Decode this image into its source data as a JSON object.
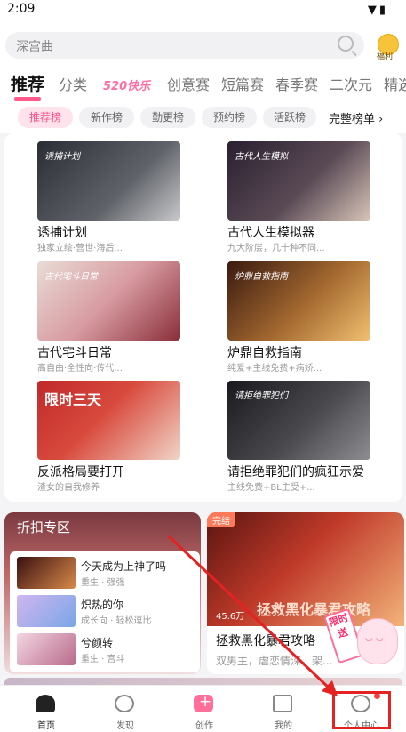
{
  "status_bar": {
    "time": "2:09"
  },
  "search": {
    "placeholder": "深宫曲"
  },
  "welfare": {
    "label": "福利"
  },
  "tabs": [
    {
      "label": "推荐"
    },
    {
      "label": "分类"
    },
    {
      "label": "520快乐"
    },
    {
      "label": "创意赛"
    },
    {
      "label": "短篇赛"
    },
    {
      "label": "春季赛"
    },
    {
      "label": "二次元"
    },
    {
      "label": "精选"
    }
  ],
  "chips": [
    {
      "label": "推荐榜"
    },
    {
      "label": "新作榜"
    },
    {
      "label": "勤更榜"
    },
    {
      "label": "预约榜"
    },
    {
      "label": "活跃榜"
    }
  ],
  "chips_more": "完整榜单 ›",
  "books": [
    {
      "title": "诱捕计划",
      "sub": "独家立绘·营世·海后...",
      "cover_text": "诱捕计划"
    },
    {
      "title": "古代人生模拟器",
      "sub": "九大阶层，几十种不同...",
      "cover_text": "古代人生模拟"
    },
    {
      "title": "古代宅斗日常",
      "sub": "高自由·全性向·传代...",
      "cover_text": "古代宅斗日常"
    },
    {
      "title": "炉鼎自救指南",
      "sub": "纯爱+主线免费+病娇...",
      "cover_text": "炉鼎自救指南"
    },
    {
      "title": "反派格局要打开",
      "sub": "渣女的自我修养",
      "cover_text": "限时三天"
    },
    {
      "title": "请拒绝罪犯们的疯狂示爱",
      "sub": "主线免费+BL主受+...",
      "cover_text": "请拒绝罪犯们"
    }
  ],
  "discount": {
    "header": "折扣专区",
    "items": [
      {
        "title": "今天成为上神了吗",
        "sub": "重生 · 强强"
      },
      {
        "title": "炽热的你",
        "sub": "成长向 · 轻松逗比"
      },
      {
        "title": "兮颜转",
        "sub": "重生 · 宫斗"
      }
    ]
  },
  "feature": {
    "status": "完结",
    "views": "45.6万",
    "overlay": "拯救黑化暴君攻略",
    "title": "拯救黑化暴君攻略",
    "sub": "双男主，虐恋情深，架..."
  },
  "promo_badge": {
    "text": "限时送"
  },
  "bottom_nav": [
    {
      "label": "首页"
    },
    {
      "label": "发现"
    },
    {
      "label": "创作"
    },
    {
      "label": "我的"
    },
    {
      "label": "个人中心"
    }
  ],
  "colors": {
    "accent": "#ff5a8a",
    "highlight": "#e52222"
  }
}
